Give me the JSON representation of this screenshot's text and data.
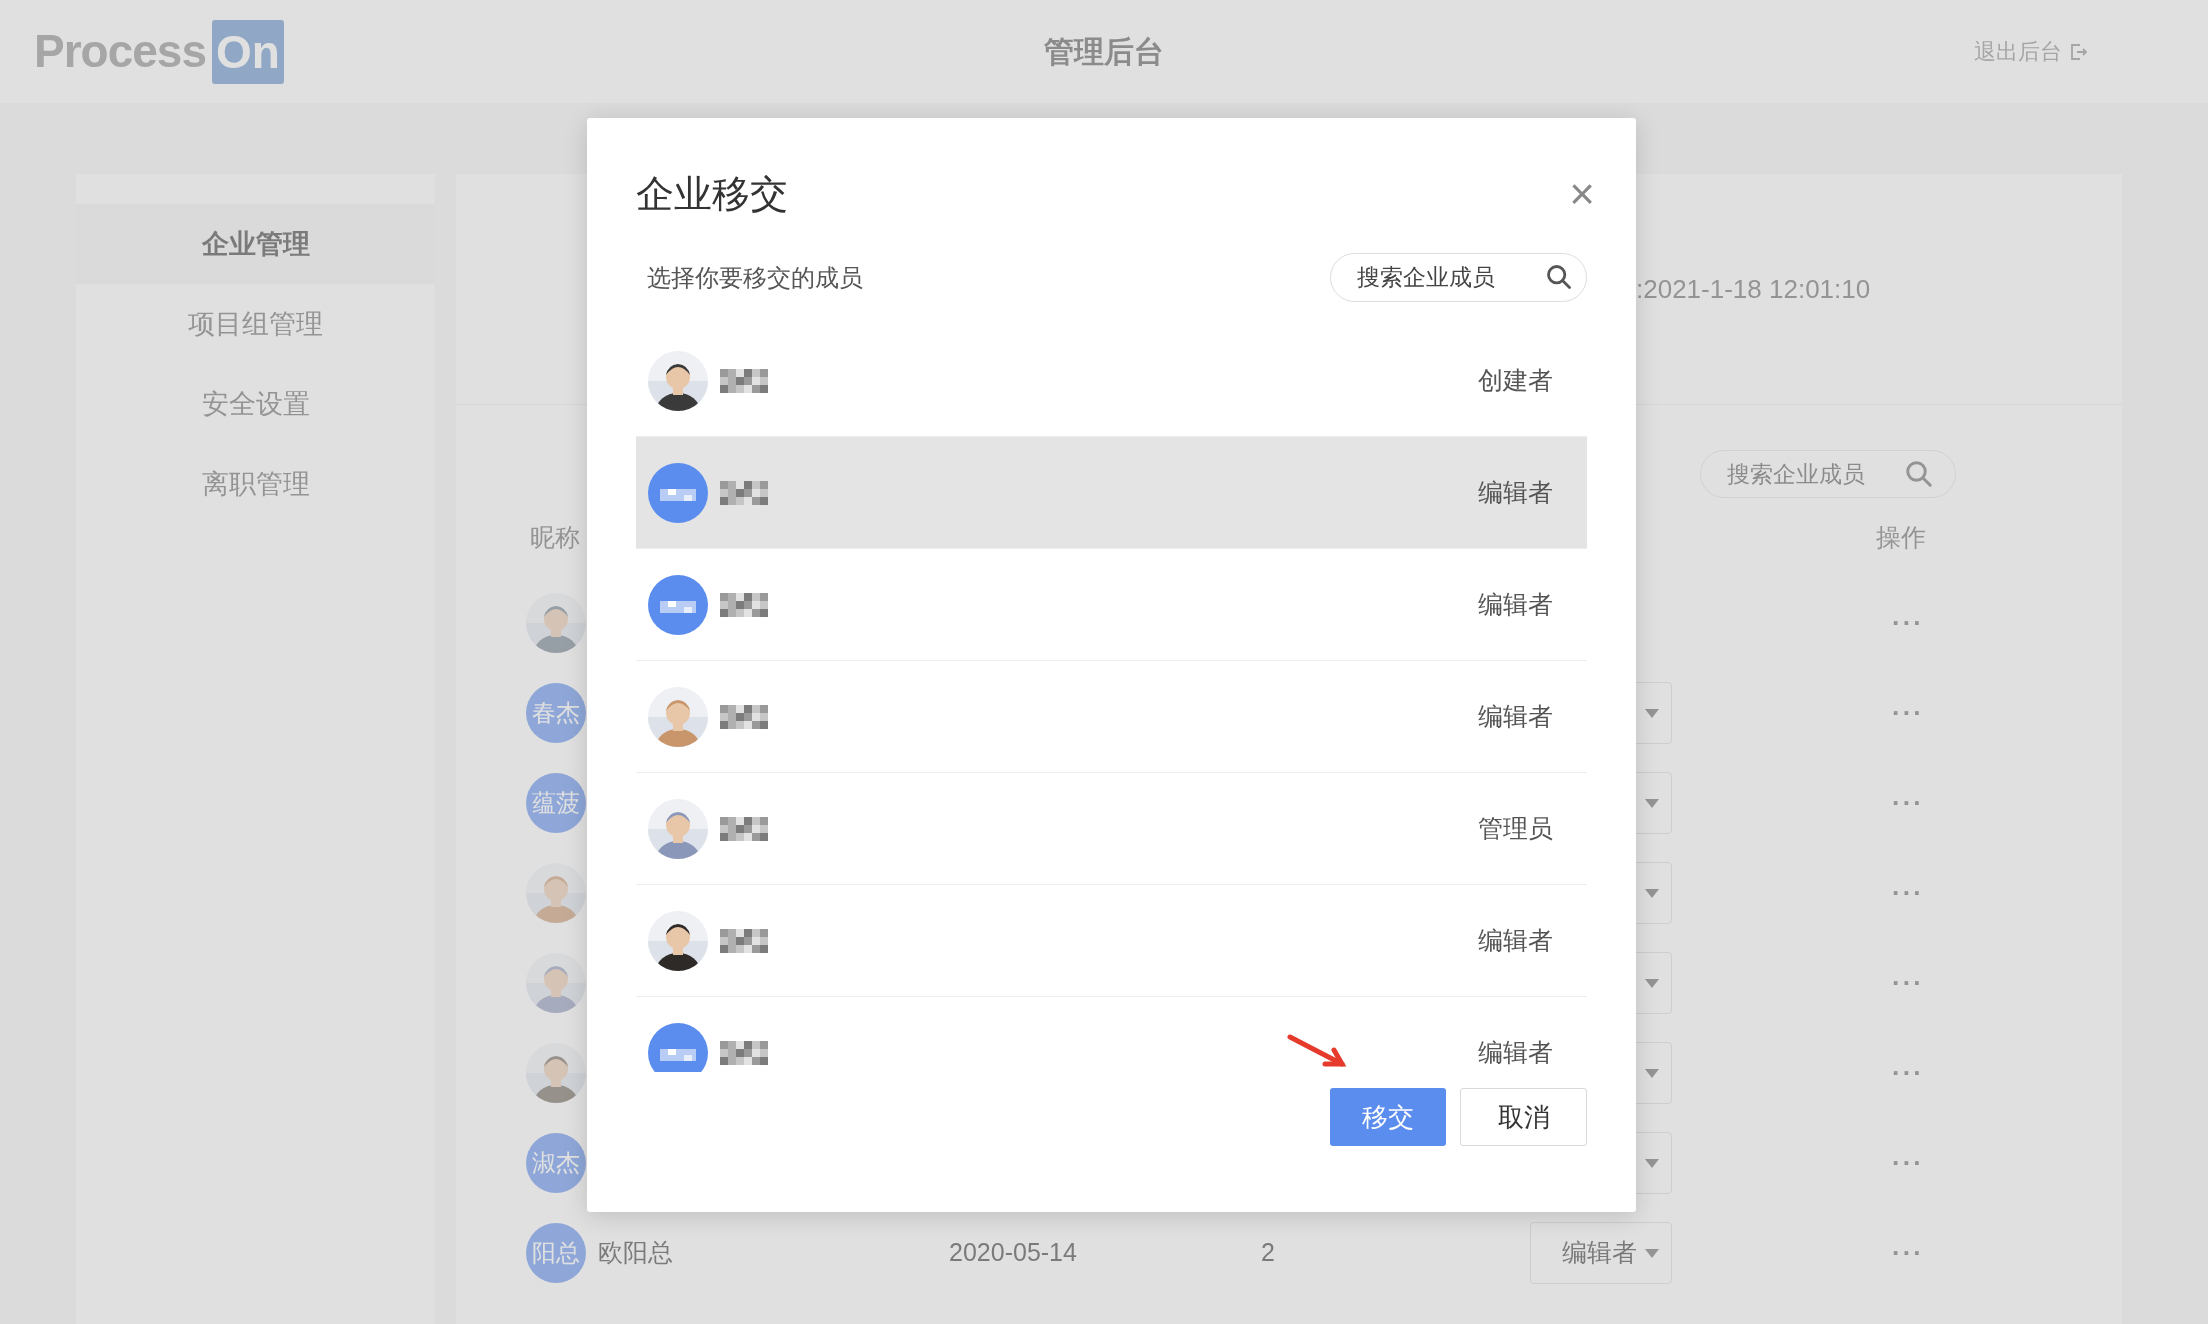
{
  "header": {
    "logo": {
      "text": "Process",
      "badge": "On"
    },
    "title": "管理后台",
    "exit_link": "退出后台"
  },
  "sidebar": {
    "items": [
      {
        "label": "企业管理",
        "selected": true
      },
      {
        "label": "项目组管理",
        "selected": false
      },
      {
        "label": "安全设置",
        "selected": false
      },
      {
        "label": "离职管理",
        "selected": false
      }
    ]
  },
  "info": {
    "created_time": ":2021-1-18 12:01:10"
  },
  "members": {
    "search": {
      "placeholder": "搜索企业成员"
    },
    "columns": [
      "昵称",
      "操作"
    ],
    "rows": [
      {
        "kind": "creator",
        "actions": "···"
      },
      {
        "kind": "member",
        "avatar": {
          "kind": "initials",
          "text": "春杰"
        },
        "actions": "···"
      },
      {
        "kind": "member",
        "avatar": {
          "kind": "initials",
          "text": "蕴菠"
        },
        "actions": "···"
      },
      {
        "kind": "member",
        "actions": "···"
      },
      {
        "kind": "member",
        "actions": "···"
      },
      {
        "kind": "member",
        "actions": "···"
      },
      {
        "kind": "member",
        "avatar": {
          "kind": "initials",
          "text": "淑杰"
        },
        "actions": "···"
      },
      {
        "kind": "member",
        "avatar": {
          "kind": "initials",
          "text": "阳总"
        },
        "name": "欧阳总",
        "joined": "2020-05-14",
        "count": "2",
        "role": "编辑者",
        "actions": "···"
      }
    ]
  },
  "dialog": {
    "title": "企业移交",
    "close": "×",
    "subtitle": "选择你要移交的成员",
    "search": {
      "placeholder": "搜索企业成员"
    },
    "members": [
      {
        "role": "创建者",
        "selected": false
      },
      {
        "avatar": {
          "kind": "initials"
        },
        "role": "编辑者",
        "selected": true
      },
      {
        "avatar": {
          "kind": "initials"
        },
        "role": "编辑者",
        "selected": false
      },
      {
        "role": "编辑者",
        "selected": false
      },
      {
        "role": "管理员",
        "selected": false
      },
      {
        "role": "编辑者",
        "selected": false
      },
      {
        "avatar": {
          "kind": "initials"
        },
        "role": "编辑者",
        "selected": false
      }
    ],
    "buttons": {
      "confirm": "移交",
      "cancel": "取消"
    }
  }
}
